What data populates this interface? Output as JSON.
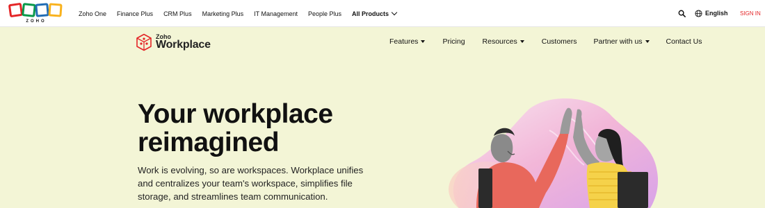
{
  "zoho_bar": {
    "logo_caption": "ZOHO",
    "logo_colors": [
      "#e42527",
      "#089949",
      "#226db4",
      "#f9b21d"
    ],
    "nav": [
      "Zoho One",
      "Finance Plus",
      "CRM Plus",
      "Marketing Plus",
      "IT Management",
      "People Plus"
    ],
    "all_products": "All Products",
    "language": "English",
    "sign_in": "SIGN IN"
  },
  "product": {
    "brand_top": "Zoho",
    "brand_name": "Workplace",
    "nav": {
      "features": "Features",
      "pricing": "Pricing",
      "resources": "Resources",
      "customers": "Customers",
      "partner": "Partner with us",
      "contact": "Contact Us"
    }
  },
  "hero": {
    "title_line1": "Your workplace",
    "title_line2": "reimagined",
    "description": "Work is evolving, so are workspaces. Workplace unifies and centralizes your team's workspace, simplifies file storage, and streamlines team communication."
  },
  "colors": {
    "background": "#f3f5d6",
    "accent_red": "#e42527",
    "brand_dark": "#222222"
  }
}
